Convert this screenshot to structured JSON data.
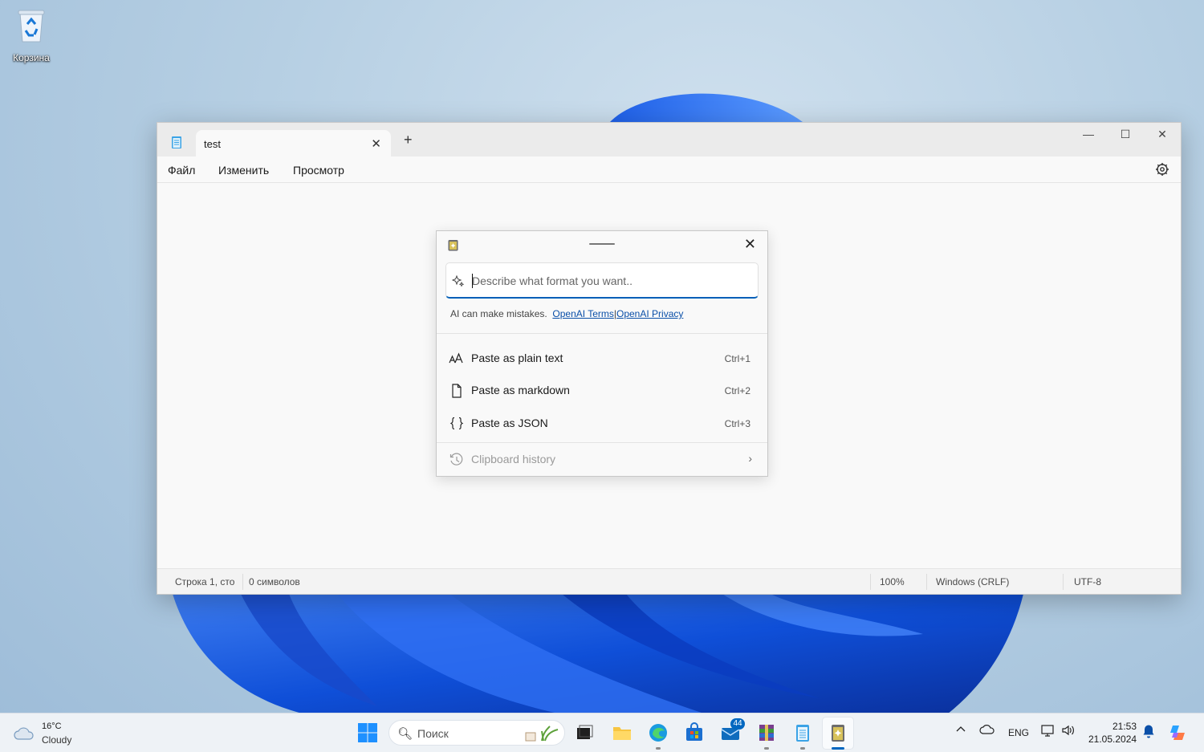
{
  "desktop": {
    "recycle_bin_label": "Корзина"
  },
  "notepad": {
    "tab_title": "test",
    "tab_close": "✕",
    "tab_add": "+",
    "window_controls": {
      "minimize": "—",
      "maximize": "☐",
      "close": "✕"
    },
    "menu": {
      "file": "Файл",
      "edit": "Изменить",
      "view": "Просмотр"
    },
    "status": {
      "position": "Строка 1, сто",
      "chars": "0 символов",
      "zoom": "100%",
      "line_ending": "Windows (CRLF)",
      "encoding": "UTF-8"
    }
  },
  "advanced_paste": {
    "close": "✕",
    "prompt_placeholder": "Describe what format you want..",
    "disclaimer": "AI can make mistakes.",
    "terms_link": "OpenAI Terms",
    "separator": "|",
    "privacy_link": "OpenAI Privacy",
    "options": [
      {
        "label": "Paste as plain text",
        "shortcut": "Ctrl+1",
        "icon": "font-size-icon"
      },
      {
        "label": "Paste as markdown",
        "shortcut": "Ctrl+2",
        "icon": "document-icon"
      },
      {
        "label": "Paste as JSON",
        "shortcut": "Ctrl+3",
        "icon": "braces-icon"
      }
    ],
    "history": {
      "label": "Clipboard history",
      "icon": "history-icon",
      "chevron": "›"
    }
  },
  "taskbar": {
    "weather_temp": "16°C",
    "weather_condition": "Cloudy",
    "search_placeholder": "Поиск",
    "mail_badge": "44",
    "language": "ENG",
    "time": "21:53",
    "date": "21.05.2024",
    "colors": {
      "accent": "#0067c0",
      "link": "#0a4fa8"
    }
  }
}
